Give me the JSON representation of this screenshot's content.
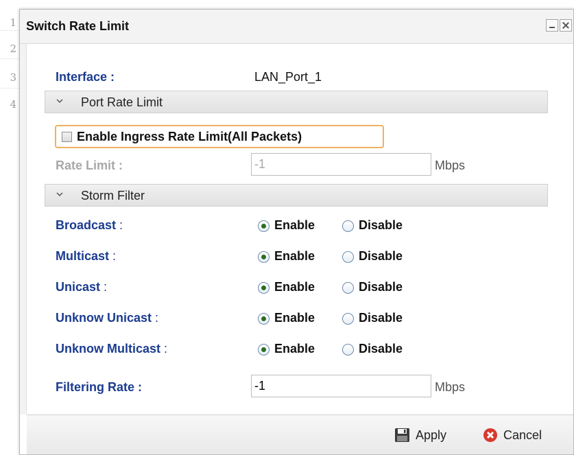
{
  "background": {
    "row_numbers": [
      "1",
      "2",
      "3",
      "4"
    ]
  },
  "dialog": {
    "title": "Switch Rate Limit",
    "interface": {
      "label": "Interface :",
      "value": "LAN_Port_1"
    },
    "port_rate_limit": {
      "section_label": "Port Rate Limit",
      "ingress_checkbox_label": "Enable Ingress Rate Limit(All Packets)",
      "ingress_checked": false,
      "rate_limit_label": "Rate Limit :",
      "rate_limit_value": "-1",
      "rate_limit_unit": "Mbps"
    },
    "storm_filter": {
      "section_label": "Storm Filter",
      "enable_label": "Enable",
      "disable_label": "Disable",
      "rows": [
        {
          "label": "Broadcast",
          "selected": "Enable"
        },
        {
          "label": "Multicast",
          "selected": "Enable"
        },
        {
          "label": "Unicast",
          "selected": "Enable"
        },
        {
          "label": "Unknow Unicast",
          "selected": "Enable"
        },
        {
          "label": "Unknow Multicast",
          "selected": "Enable"
        }
      ],
      "colon": ":",
      "filtering_rate_label": "Filtering Rate :",
      "filtering_rate_value": "-1",
      "filtering_rate_unit": "Mbps"
    },
    "footer": {
      "apply_label": "Apply",
      "cancel_label": "Cancel"
    }
  },
  "colors": {
    "label_blue": "#1b3c8f",
    "highlight_orange": "#f0b060",
    "cancel_red": "#d83a2e"
  },
  "icons": {
    "apply": "floppy-disk-icon",
    "cancel": "cancel-x-icon",
    "section": "chevron-down-icon"
  }
}
